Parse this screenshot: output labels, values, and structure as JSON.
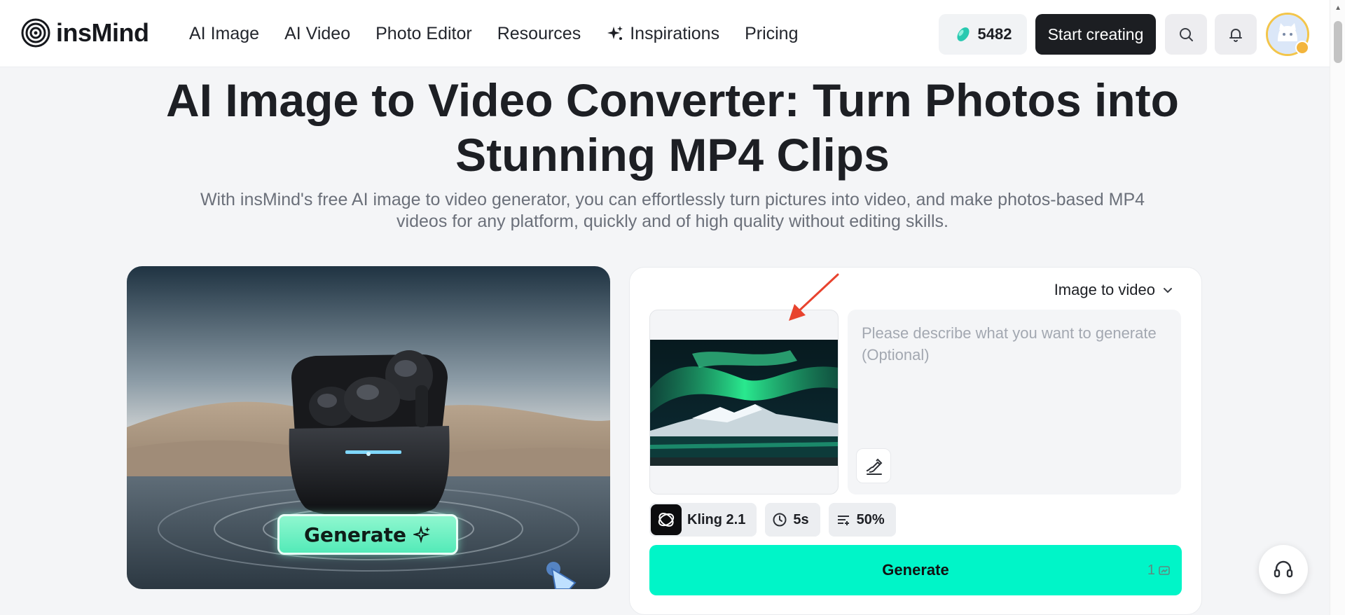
{
  "header": {
    "logo_text": "insMind",
    "nav": [
      {
        "label": "AI Image"
      },
      {
        "label": "AI Video"
      },
      {
        "label": "Photo Editor"
      },
      {
        "label": "Resources"
      },
      {
        "label": "Inspirations",
        "icon": "sparkle-icon"
      },
      {
        "label": "Pricing"
      }
    ],
    "credits": "5482",
    "start_label": "Start creating"
  },
  "hero": {
    "title_line1": "AI Image to Video Converter: Turn Photos into",
    "title_line2": "Stunning MP4 Clips",
    "subtitle_line1": "With insMind's free AI image to video generator, you can effortlessly turn pictures into video, and make photos-based MP4",
    "subtitle_line2": "videos for any platform, quickly and of high quality without editing skills."
  },
  "preview": {
    "button_label": "Generate"
  },
  "panel": {
    "mode": "Image to video",
    "prompt_placeholder": "Please describe what you want to generate (Optional)",
    "model": "Kling 2.1",
    "duration": "5s",
    "strength": "50%",
    "generate_label": "Generate",
    "generate_cost": "1"
  },
  "colors": {
    "accent": "#00f5c8",
    "dark_button": "#1c1e22",
    "arrow": "#e8432e"
  }
}
